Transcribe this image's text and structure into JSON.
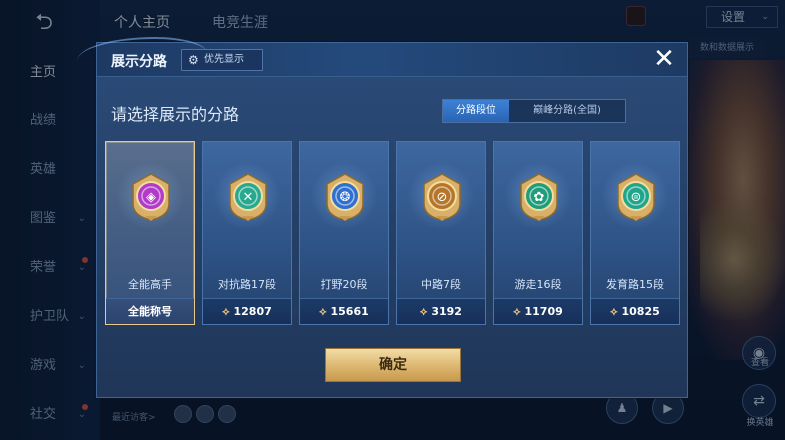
{
  "top_tabs": [
    "个人主页",
    "电竞生涯"
  ],
  "settings_label": "设置",
  "background_tip": "数和数据展示",
  "nav": [
    {
      "label": "主页",
      "active": true
    },
    {
      "label": "战绩"
    },
    {
      "label": "英雄"
    },
    {
      "label": "图鉴",
      "chevron": true
    },
    {
      "label": "荣誉",
      "chevron": true,
      "dot": true
    },
    {
      "label": "护卫队",
      "chevron": true
    },
    {
      "label": "游戏",
      "chevron": true
    },
    {
      "label": "社交",
      "chevron": true,
      "dot": true
    }
  ],
  "bottom": {
    "recent_visitors": "最近访客>"
  },
  "side_labels": [
    "查看",
    "换英雄"
  ],
  "modal": {
    "title": "展示分路",
    "priority_label": "优先显示",
    "close_icon": "close-icon",
    "subtitle": "请选择展示的分路",
    "toggle": {
      "options": [
        "分路段位",
        "巅峰分路(全国)"
      ],
      "selected": 0
    },
    "cards": [
      {
        "name": "全能高手",
        "foot": "全能称号",
        "selected": true,
        "color": "#b23ac9",
        "points": null
      },
      {
        "name": "对抗路17段",
        "foot": "12807",
        "color": "#27a88f",
        "points": true
      },
      {
        "name": "打野20段",
        "foot": "15661",
        "color": "#2f6fd0",
        "points": true
      },
      {
        "name": "中路7段",
        "foot": "3192",
        "color": "#b5752a",
        "points": true
      },
      {
        "name": "游走16段",
        "foot": "11709",
        "color": "#1f9c7a",
        "points": true
      },
      {
        "name": "发育路15段",
        "foot": "10825",
        "color": "#1fa58a",
        "points": true
      }
    ],
    "confirm_label": "确定"
  }
}
